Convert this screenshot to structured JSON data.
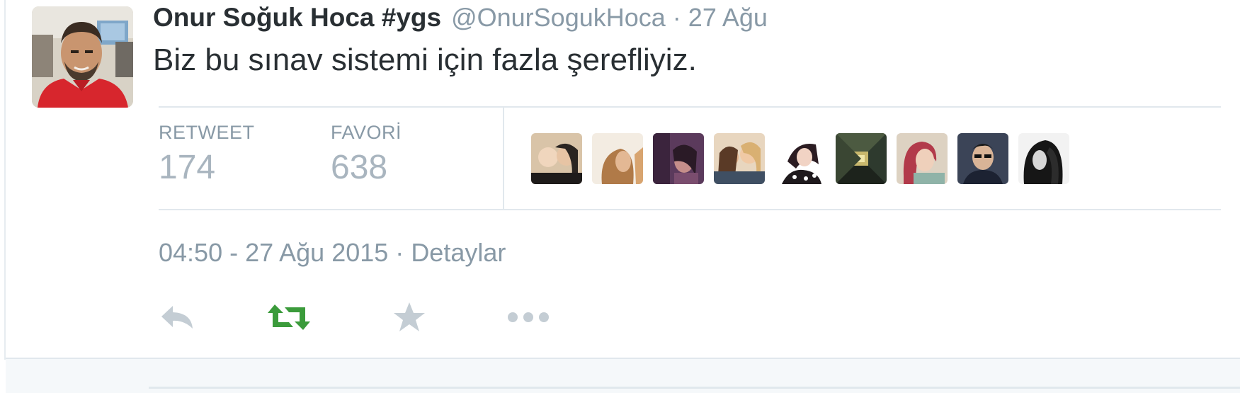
{
  "tweet": {
    "author": {
      "fullname": "Onur Soğuk Hoca #ygs",
      "username": "@OnurSogukHoca",
      "separator": "·",
      "time": "27 Ağu"
    },
    "text": "Biz bu sınav sistemi için fazla şerefliyiz.",
    "stats": {
      "retweet_label": "RETWEET",
      "retweet_count": "174",
      "favorite_label": "FAVORİ",
      "favorite_count": "638"
    },
    "favoriters_count_shown": 9,
    "meta": {
      "timestamp": "04:50 - 27 Ağu 2015",
      "separator": "·",
      "details_link": "Detaylar"
    },
    "actions": {
      "reply_icon": "reply-icon",
      "retweet_icon": "retweet-icon",
      "favorite_icon": "star-icon",
      "more_icon": "more-icon",
      "retweeted": true,
      "retweet_active_color": "#3b9b3b",
      "inactive_color": "#c4cdd4"
    }
  }
}
